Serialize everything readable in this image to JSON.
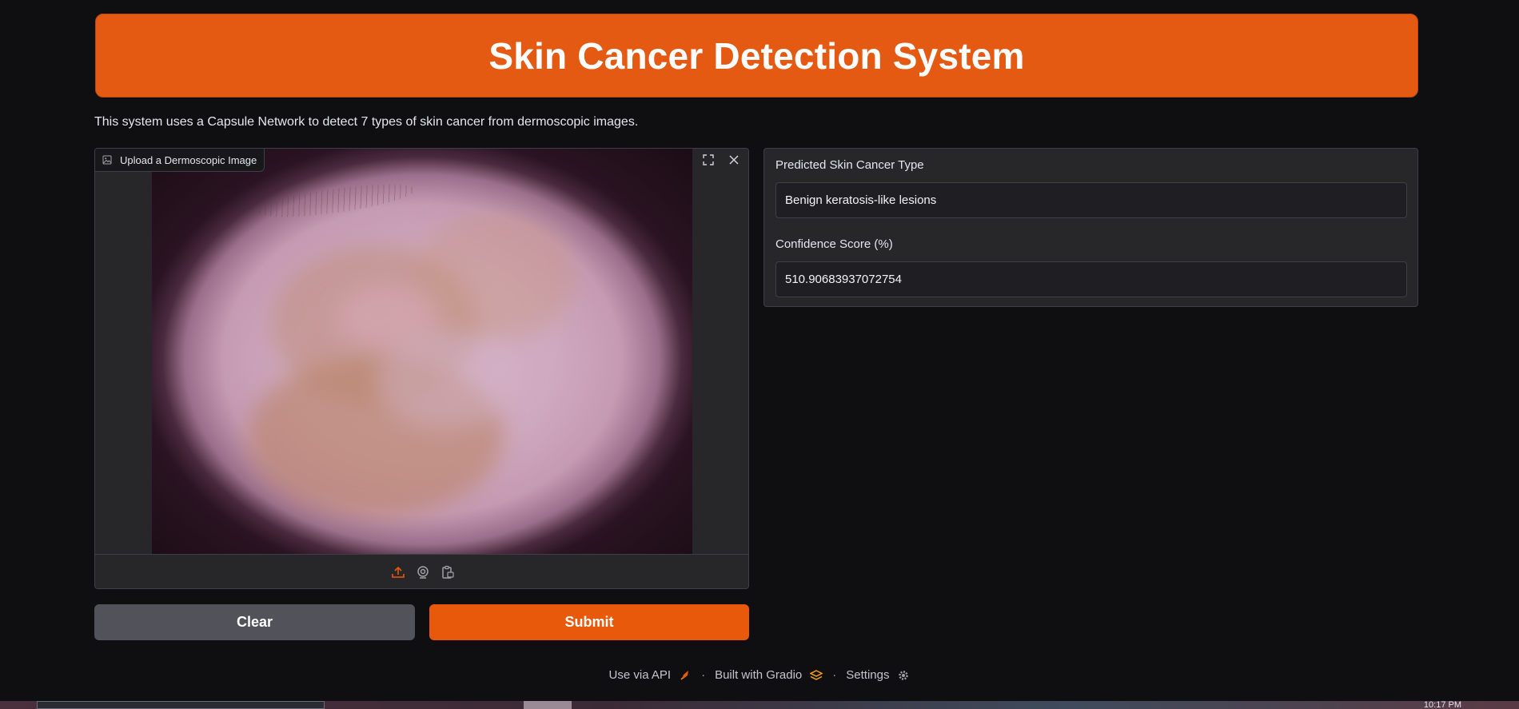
{
  "header": {
    "title": "Skin Cancer Detection System"
  },
  "description": "This system uses a Capsule Network to detect 7 types of skin cancer from dermoscopic images.",
  "image_input": {
    "label": "Upload a Dermoscopic Image",
    "label_icon": "image-icon",
    "top_icons": [
      "fullscreen-icon",
      "close-icon"
    ],
    "source_icons": [
      "upload-icon",
      "webcam-icon",
      "clipboard-icon"
    ]
  },
  "buttons": {
    "clear": "Clear",
    "submit": "Submit"
  },
  "outputs": {
    "type_label": "Predicted Skin Cancer Type",
    "type_value": "Benign keratosis-like lesions",
    "score_label": "Confidence Score (%)",
    "score_value": "510.90683937072754"
  },
  "footer": {
    "api": "Use via API",
    "api_icon": "rocket-icon",
    "built": "Built with Gradio",
    "built_icon": "gradio-logo-icon",
    "settings": "Settings",
    "settings_icon": "gear-icon",
    "separator": "·"
  },
  "taskbar": {
    "clock": "10:17 PM"
  },
  "colors": {
    "accent": "#e8590c",
    "background": "#0f0f11",
    "panel": "#27272a"
  }
}
